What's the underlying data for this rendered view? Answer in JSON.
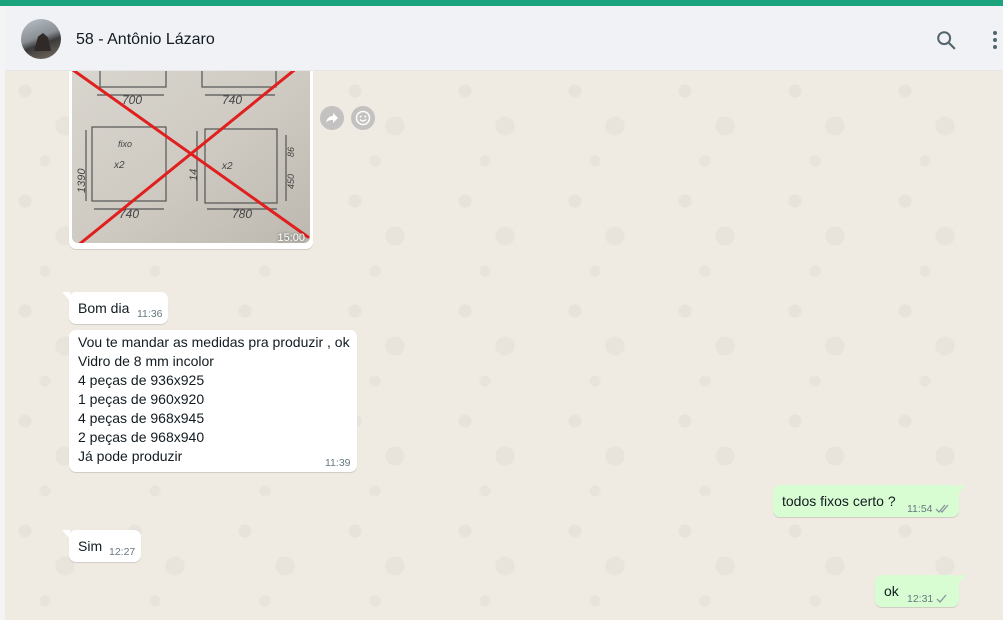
{
  "header": {
    "contact_name": "58 - Antônio Lázaro",
    "icons": [
      "search-icon",
      "menu-kebab-icon"
    ]
  },
  "colors": {
    "top_bar": "#1aa37c",
    "incoming_bubble": "#ffffff",
    "outgoing_bubble": "#d9fdd3",
    "chat_background": "#efeae2",
    "read_tick": "#53bdeb"
  },
  "image_message": {
    "time": "15:00",
    "drawing_labels": [
      "700",
      "740",
      "fixo",
      "x2",
      "1390",
      "740",
      "14",
      "x2",
      "780",
      "450",
      "86"
    ],
    "actions": [
      "forward-icon",
      "emoji-icon"
    ]
  },
  "messages": [
    {
      "direction": "in",
      "text": "Bom dia",
      "time": "11:36"
    },
    {
      "direction": "in",
      "lines": [
        "Vou te mandar as medidas pra produzir , ok",
        "Vidro de 8 mm incolor",
        "4 peças de 936x925",
        "1 peças de 960x920",
        "4 peças de 968x945",
        "2 peças de 968x940",
        "Já pode produzir"
      ],
      "time": "11:39"
    },
    {
      "direction": "out",
      "text": "todos fixos certo ?",
      "time": "11:54",
      "status": "double-check-icon"
    },
    {
      "direction": "in",
      "text": "Sim",
      "time": "12:27"
    },
    {
      "direction": "out",
      "text": "ok",
      "time": "12:31",
      "status": "single-check-icon"
    }
  ]
}
